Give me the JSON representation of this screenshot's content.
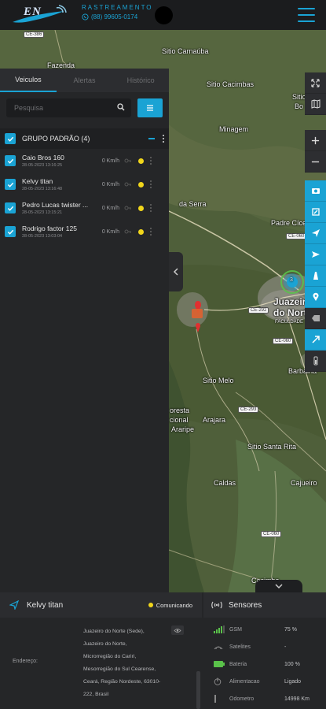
{
  "header": {
    "logo_text": "EN",
    "brand_sub": "RASTREAMENTO",
    "phone": "(88) 99605-0174"
  },
  "map": {
    "labels": {
      "fazenda": "Fazenda",
      "sitio_carnauba": "Sitio Carnaúba",
      "sitio_cacimbas": "Sitio Cacimbas",
      "sitio_d": "Sitio do",
      "sitio_bo": "Bo",
      "minagem": "Minagem",
      "da_serra": "da Serra",
      "padre_cicero": "Padre Cícero",
      "juazeiro": "Juazeiro",
      "do_norte": "do Norte",
      "faculdade": "FACULDADE",
      "sitio_melo": "Sitio Melo",
      "barbalha": "Barbalha",
      "floresta": "oresta",
      "nacional": "cional",
      "araripe": "Araripe",
      "arajara": "Arajara",
      "sitio_santa_rita": "Sitio Santa Rita",
      "caldas": "Caldas",
      "cajueiro": "Cajueiro",
      "cacimba": "Cacimba"
    },
    "roads": [
      "CE-386",
      "CE-060",
      "CE-292",
      "CE-060",
      "CE-293",
      "CE-060"
    ],
    "cluster_count": "3"
  },
  "panel": {
    "tabs": [
      "Veiculos",
      "Alertas",
      "Histórico"
    ],
    "search_placeholder": "Pesquisa",
    "group_title": "GRUPO PADRÃO (4)",
    "vehicles": [
      {
        "name": "Caio Bros 160",
        "date": "28-05-2023 13:16:25",
        "speed": "0 Km/h"
      },
      {
        "name": "Kelvy titan",
        "date": "28-05-2023 13:16:48",
        "speed": "0 Km/h"
      },
      {
        "name": "Pedro Lucas twister ...",
        "date": "28-05-2023 13:15:21",
        "speed": "0 Km/h"
      },
      {
        "name": "Rodrigo factor 125",
        "date": "28-05-2023 13:03:04",
        "speed": "0 Km/h"
      }
    ]
  },
  "bottom": {
    "vehicle_title": "Kelvy titan",
    "status": "Comunicando",
    "sensors_title": "Sensores",
    "address_label": "Endereço:",
    "address_lines": [
      "Juazeiro do Norte (Sede),",
      "Juazeiro do Norte,",
      "Microrregião do Cariri,",
      "Mesorregião do Sul Cearense,",
      "Ceará, Região Nordeste, 63010-",
      "222, Brasil"
    ],
    "sensors": [
      {
        "name": "GSM",
        "value": "75 %"
      },
      {
        "name": "Satelites",
        "value": "-"
      },
      {
        "name": "Bateria",
        "value": "100 %"
      },
      {
        "name": "Alimentacao",
        "value": "Ligado"
      },
      {
        "name": "Odometro",
        "value": "14998 Km"
      }
    ]
  },
  "colors": {
    "accent": "#1aa3d4",
    "status_dot": "#f1d61b",
    "panel_bg": "#252628",
    "signal_green": "#5ac24a"
  }
}
